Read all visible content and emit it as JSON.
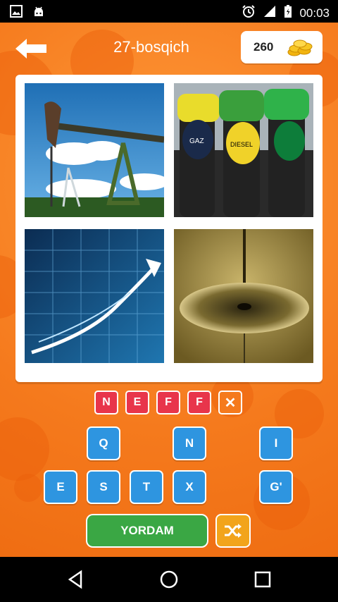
{
  "status_bar": {
    "left_icons": [
      "image-icon",
      "android-icon"
    ],
    "right_icons": [
      "alarm-icon",
      "signal-icon",
      "battery-icon"
    ],
    "time": "00:03"
  },
  "header": {
    "back_icon": "arrow-left-icon",
    "title": "27-bosqich",
    "coins": "260",
    "coin_icon": "coins-icon"
  },
  "pictures": [
    {
      "name": "oil-pump-jack-photo"
    },
    {
      "name": "fuel-nozzles-photo"
    },
    {
      "name": "stock-market-arrow-photo"
    },
    {
      "name": "oil-drop-photo"
    }
  ],
  "answer": {
    "letters": [
      "N",
      "E",
      "F",
      "F"
    ],
    "clear_icon": "close-icon"
  },
  "keyboard": {
    "row1": [
      "Q",
      "N",
      "I"
    ],
    "row2": [
      "E",
      "S",
      "T",
      "X",
      "G'"
    ]
  },
  "actions": {
    "help_label": "YORDAM",
    "shuffle_icon": "shuffle-icon"
  },
  "nav_bar": [
    "back-icon",
    "home-icon",
    "recents-icon"
  ],
  "colors": {
    "background": "#f47a1f",
    "slot": "#e8354b",
    "key": "#2e95e0",
    "help": "#3aa744",
    "shuffle": "#f2a41b"
  }
}
